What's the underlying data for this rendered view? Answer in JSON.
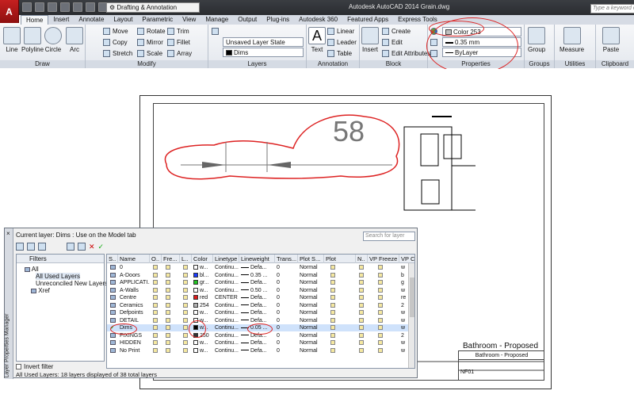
{
  "app": {
    "icon_letter": "A",
    "title": "Autodesk AutoCAD 2014    Grain.dwg",
    "search_placeholder": "Type a keyword or...",
    "workspace": "Drafting & Annotation"
  },
  "tabs": [
    "Home",
    "Insert",
    "Annotate",
    "Layout",
    "Parametric",
    "View",
    "Manage",
    "Output",
    "Plug-ins",
    "Autodesk 360",
    "Featured Apps",
    "Express Tools"
  ],
  "ribbon": {
    "draw": {
      "title": "Draw",
      "tools": [
        "Line",
        "Polyline",
        "Circle",
        "Arc"
      ]
    },
    "modify": {
      "title": "Modify",
      "tools": [
        "Move",
        "Rotate",
        "Trim",
        "Copy",
        "Mirror",
        "Fillet",
        "Stretch",
        "Scale",
        "Array"
      ]
    },
    "layers": {
      "title": "Layers",
      "layer_state": "Unsaved Layer State",
      "current_layer": "Dims"
    },
    "annotation": {
      "title": "Annotation",
      "text": "Text",
      "tools": [
        "Linear",
        "Leader",
        "Table"
      ]
    },
    "block": {
      "title": "Block",
      "insert": "Insert",
      "tools": [
        "Create",
        "Edit",
        "Edit Attributes"
      ]
    },
    "properties": {
      "title": "Properties",
      "color": "Color 253",
      "lineweight": "0.35 mm",
      "linetype": "ByLayer"
    },
    "groups": {
      "title": "Groups",
      "group": "Group"
    },
    "utilities": {
      "title": "Utilities",
      "measure": "Measure"
    },
    "clipboard": {
      "title": "Clipboard",
      "paste": "Paste"
    }
  },
  "drawing": {
    "dimension_value": "58",
    "sheet_title": "Bathroom - Proposed",
    "title_block_title": "Bathroom - Proposed",
    "sheet_no": "NF01"
  },
  "layer_manager": {
    "side_title": "Layer Properties Manager",
    "close": "×",
    "current_layer": "Current layer: Dims : Use on the Model tab",
    "search_placeholder": "Search for layer",
    "filters_header": "Filters",
    "tree": [
      "All",
      "All Used Layers",
      "Unreconciled New Layers",
      "Xref"
    ],
    "invert_filter": "Invert filter",
    "status": "All Used Layers: 18 layers displayed of 38 total layers",
    "columns": [
      "S..",
      "Name",
      "O..",
      "Fre...",
      "L..",
      "Color",
      "Linetype",
      "Lineweight",
      "Trans...",
      "Plot S...",
      "Plot",
      "N..",
      "VP Freeze",
      "VP C"
    ],
    "rows": [
      {
        "name": "0",
        "color": "w...",
        "swatch": "#ffffff",
        "linetype": "Continu...",
        "lineweight": "Defa...",
        "trans": "0",
        "plotstyle": "Normal",
        "vpc": "w"
      },
      {
        "name": "A-Doors",
        "color": "bl...",
        "swatch": "#1a3cff",
        "linetype": "Continu...",
        "lineweight": "0.35 ...",
        "trans": "0",
        "plotstyle": "Normal",
        "vpc": "b"
      },
      {
        "name": "APPLICATI...",
        "color": "gr...",
        "swatch": "#22c322",
        "linetype": "Continu...",
        "lineweight": "Defa...",
        "trans": "0",
        "plotstyle": "Normal",
        "vpc": "g"
      },
      {
        "name": "A-Walls",
        "color": "w...",
        "swatch": "#ffffff",
        "linetype": "Continu...",
        "lineweight": "0.50 ...",
        "trans": "0",
        "plotstyle": "Normal",
        "vpc": "w"
      },
      {
        "name": "Centre",
        "color": "red",
        "swatch": "#e01b1b",
        "linetype": "CENTER",
        "lineweight": "Defa...",
        "trans": "0",
        "plotstyle": "Normal",
        "vpc": "re"
      },
      {
        "name": "Ceramics",
        "color": "254",
        "swatch": "#b3b3b3",
        "linetype": "Continu...",
        "lineweight": "Defa...",
        "trans": "0",
        "plotstyle": "Normal",
        "vpc": "2"
      },
      {
        "name": "Defpoints",
        "color": "w...",
        "swatch": "#ffffff",
        "linetype": "Continu...",
        "lineweight": "Defa...",
        "trans": "0",
        "plotstyle": "Normal",
        "vpc": "w"
      },
      {
        "name": "DETAIL",
        "color": "w...",
        "swatch": "#ffffff",
        "linetype": "Continu...",
        "lineweight": "Defa...",
        "trans": "0",
        "plotstyle": "Normal",
        "vpc": "w"
      },
      {
        "name": "Dims",
        "color": "w...",
        "swatch": "#000000",
        "linetype": "Continu...",
        "lineweight": "0.05 ...",
        "trans": "0",
        "plotstyle": "Normal",
        "vpc": "w",
        "current": true
      },
      {
        "name": "FIXINGS",
        "color": "250",
        "swatch": "#333333",
        "linetype": "Continu...",
        "lineweight": "Defa...",
        "trans": "0",
        "plotstyle": "Normal",
        "vpc": "2"
      },
      {
        "name": "HIDDEN",
        "color": "w...",
        "swatch": "#ffffff",
        "linetype": "Continu...",
        "lineweight": "Defa...",
        "trans": "0",
        "plotstyle": "Normal",
        "vpc": "w"
      },
      {
        "name": "No Print",
        "color": "w...",
        "swatch": "#ffffff",
        "linetype": "Continu...",
        "lineweight": "Defa...",
        "trans": "0",
        "plotstyle": "Normal",
        "vpc": "w"
      }
    ]
  }
}
